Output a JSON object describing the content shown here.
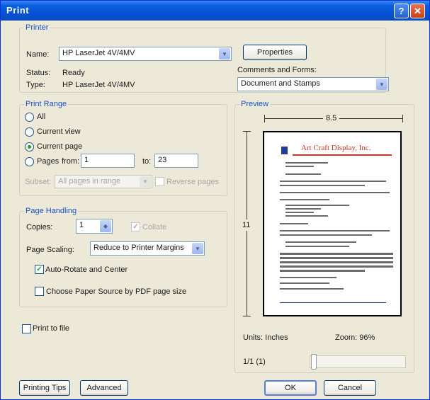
{
  "window": {
    "title": "Print",
    "help": "?",
    "close": "✕"
  },
  "printer": {
    "group_label": "Printer",
    "name_label": "Name:",
    "name_value": "HP LaserJet 4V/4MV",
    "status_label": "Status:",
    "status_value": "Ready",
    "type_label": "Type:",
    "type_value": "HP LaserJet 4V/4MV",
    "properties_button": "Properties",
    "comments_label": "Comments and Forms:",
    "comments_value": "Document and Stamps"
  },
  "print_range": {
    "group_label": "Print Range",
    "all": "All",
    "current_view": "Current view",
    "current_page": "Current page",
    "pages_label": "Pages",
    "from_label": "from:",
    "from_value": "1",
    "to_label": "to:",
    "to_value": "23",
    "subset_label": "Subset:",
    "subset_value": "All pages in range",
    "reverse_pages": "Reverse pages"
  },
  "page_handling": {
    "group_label": "Page Handling",
    "copies_label": "Copies:",
    "copies_value": "1",
    "collate": "Collate",
    "scaling_label": "Page Scaling:",
    "scaling_value": "Reduce to Printer Margins",
    "auto_rotate": "Auto-Rotate and Center",
    "paper_source": "Choose Paper Source by PDF page size"
  },
  "print_to_file": "Print to file",
  "preview": {
    "group_label": "Preview",
    "width_label": "8.5",
    "height_label": "11",
    "doc_heading": "Art Craft Display, Inc.",
    "units_label": "Units: Inches",
    "zoom_label": "Zoom: 96%",
    "page_indicator": "1/1 (1)"
  },
  "footer": {
    "printing_tips": "Printing Tips",
    "advanced": "Advanced",
    "ok": "OK",
    "cancel": "Cancel"
  }
}
